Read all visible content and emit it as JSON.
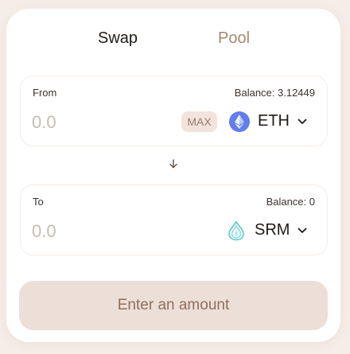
{
  "tabs": {
    "swap": "Swap",
    "pool": "Pool"
  },
  "from": {
    "label": "From",
    "balance": "Balance: 3.12449",
    "amount_placeholder": "0.0",
    "max_label": "MAX",
    "token": {
      "symbol": "ETH",
      "icon": "ethereum-icon"
    }
  },
  "to": {
    "label": "To",
    "balance": "Balance: 0",
    "amount_placeholder": "0.0",
    "token": {
      "symbol": "SRM",
      "icon": "serum-icon"
    }
  },
  "swap_direction_icon": "arrow-down-icon",
  "cta": {
    "label": "Enter an amount"
  },
  "colors": {
    "background": "#f6ede8",
    "accent_text": "#8f6f5d",
    "button_bg": "#ecdfd8",
    "eth_blue": "#627eea",
    "srm_teal": "#5cc6d3"
  }
}
